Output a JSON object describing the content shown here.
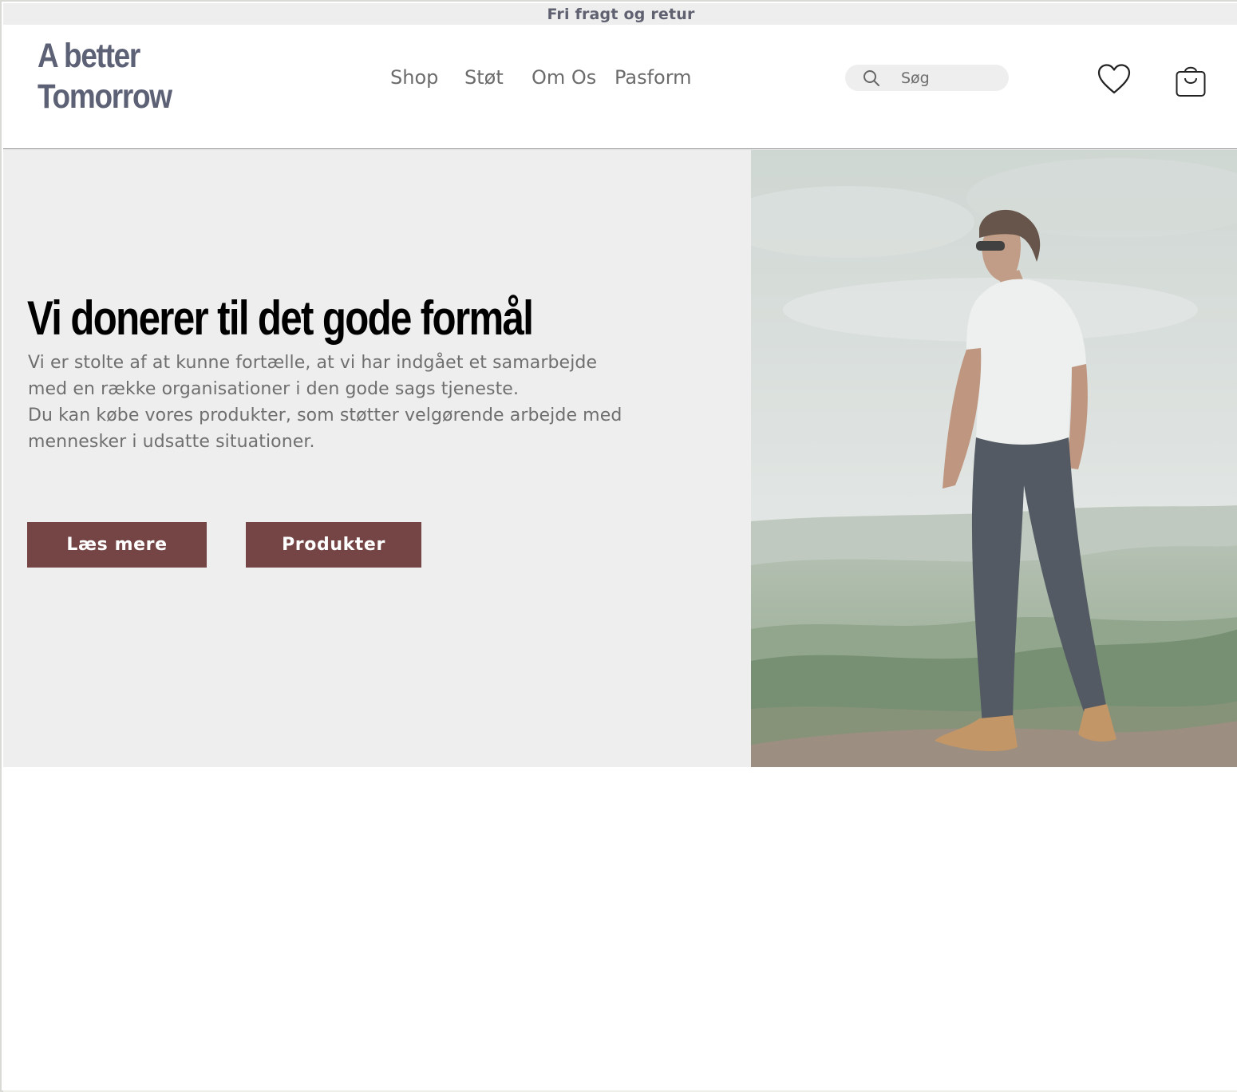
{
  "promo": {
    "text": "Fri fragt og retur"
  },
  "brand": {
    "line1": "A better",
    "line2": "Tomorrow"
  },
  "nav": {
    "items": [
      {
        "label": "Shop"
      },
      {
        "label": "Støt"
      },
      {
        "label": "Om Os"
      },
      {
        "label": "Pasform"
      }
    ]
  },
  "search": {
    "placeholder": "Søg",
    "icon": "search-icon"
  },
  "header_icons": {
    "wishlist": "heart-icon",
    "cart": "shopping-bag-icon"
  },
  "hero": {
    "title": "Vi donerer til det gode formål",
    "paragraph_1": "Vi er stolte af at kunne fortælle, at vi har indgået et samarbejde med en række organisationer i den gode sags tjeneste.",
    "paragraph_2": "Du kan købe vores produkter, som støtter velgørende arbejde med mennesker i udsatte situationer.",
    "buttons": {
      "read_more": "Læs mere",
      "products": "Produkter"
    }
  },
  "colors": {
    "accent": "#754545",
    "brand_text": "#5d6175",
    "panel_bg": "#eeeeee",
    "body_text": "#6f6f6f"
  }
}
